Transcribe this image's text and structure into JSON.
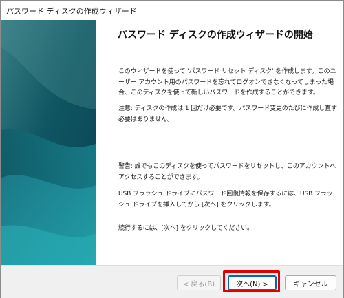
{
  "window": {
    "title": "パスワード ディスクの作成ウィザード"
  },
  "content": {
    "heading": "パスワード ディスクの作成ウィザードの開始",
    "paragraphs": [
      "このウィザードを使って 'パスワード リセット ディスク' を作成します。このユーザー アカウント用のパスワードを忘れてログオンできなくなってしまった場合、このディスクを使って新しいパスワードを作成することができます。",
      "注意: ディスクの作成は 1 回だけ必要です。パスワード変更のたびに作成し直す必要はありません。",
      "警告: 誰でもこのディスクを使ってパスワードをリセットし、このアカウントへアクセスすることができます。",
      "USB フラッシュ ドライブにパスワード回復情報を保存するには、USB フラッシュ ドライブを挿入してから [次へ] をクリックします。",
      "続行するには、[次へ] をクリックしてください。"
    ]
  },
  "buttons": {
    "back": "< 戻る(B)",
    "next": "次へ(N) >",
    "cancel": "キャンセル"
  },
  "colors": {
    "side_panel_dark": "#0c4f5e",
    "side_panel_light": "#2a9aa6",
    "highlight": "#e00000",
    "default_button_border": "#0067c0"
  }
}
